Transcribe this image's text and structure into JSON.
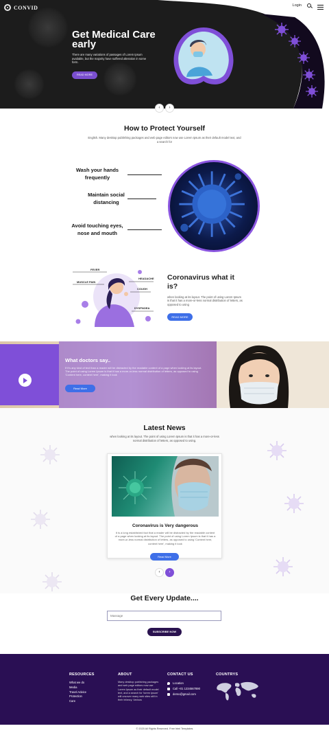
{
  "brand": {
    "name": "CONVID"
  },
  "nav": {
    "login": "Login"
  },
  "hero": {
    "title": "Get Medical Care early",
    "text": "There are many variations of passages of Lorem Ipsum available, but the majority have suffered alteration in some form.",
    "button": "READ MORE"
  },
  "protect": {
    "title": "How to Protect Yourself",
    "subtitle": "English. Many desktop publishing packages and web page editors now use Lorem Ipsum as their default model text, and a search for",
    "items": [
      "Wash your hands frequently",
      "Maintain social distancing",
      "Avoid touching eyes, nose and mouth"
    ]
  },
  "corona": {
    "title": "Coronavirus what it is?",
    "text": "when looking at its layout. The point of using Lorem Ipsum is that it has a more-or-less normal distribution of letters, as opposed to using",
    "button": "READ MORE",
    "symptoms": [
      "FEVER",
      "HEADACHE",
      "MUSCLE PAIN",
      "COUGH",
      "DYSPNOEA"
    ]
  },
  "doctors": {
    "title": "What doctors say..",
    "text": "If it's any kind of text than a reader will be distracted by the readable content of a page when looking at its layout. The point of using Lorem Ipsum is that it has a more-or-less normal distribution of letters, as opposed to using 'Content here, content here', making it look",
    "button": "Read More"
  },
  "news": {
    "title": "Latest News",
    "subtitle": "when looking at its layout. The point of using Lorem Ipsum is that it has a more-or-less normal distribution of letters, as opposed to using.",
    "card_title": "Coronavirus is Very dangerous",
    "card_text": "It is a long established fact that a reader will be distracted by the readable content of a page when looking at its layout. The point of using Lorem Ipsum is that it has a more-or-less normal distribution of letters, as opposed to using 'Content here, content here', making it look",
    "button": "Read More"
  },
  "subscribe": {
    "title": "Get Every Update....",
    "placeholder": "Massage",
    "button": "SUBSCRIBE NOW"
  },
  "footer": {
    "resources": {
      "title": "RESOURCES",
      "links": [
        "What we do",
        "Media",
        "Travel Advice",
        "Protection",
        "Care"
      ]
    },
    "about": {
      "title": "ABOUT",
      "text": "Many desktop publishing packages and web page editors now use Lorem Ipsum as their default model text, and a search for 'lorem ipsum' will uncover many web sites still in their infancy. Various"
    },
    "contact": {
      "title": "CONTACT US",
      "location": "Location",
      "phone": "Call +01 1234567890",
      "email": "demo@gmail.com"
    },
    "countrys": {
      "title": "COUNTRYS"
    },
    "copyright": "© 2020 All Rights Reserved. Free html Templates"
  },
  "colors": {
    "purple": "#7f4fd8",
    "blue": "#3e6fe8",
    "dark_purple": "#2a0f54"
  }
}
